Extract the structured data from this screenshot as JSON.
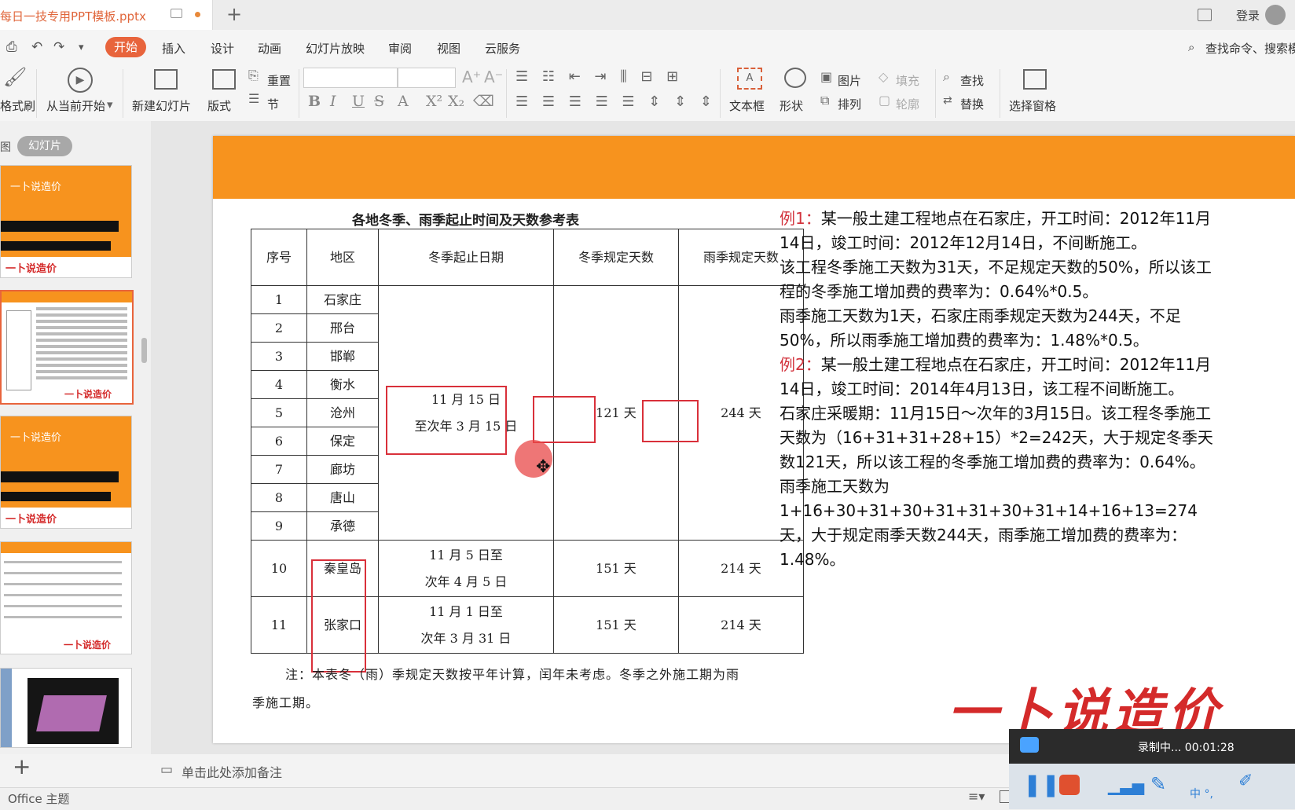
{
  "titlebar": {
    "doc_name": "每日一技专用PPT模板.pptx",
    "login": "登录",
    "new_tab": "+"
  },
  "menu": {
    "start": "开始",
    "items": [
      "插入",
      "设计",
      "动画",
      "幻灯片放映",
      "审阅",
      "视图",
      "云服务"
    ],
    "search": "查找命令、搜索模"
  },
  "ribbon": {
    "format_painter": "格式刷",
    "from_current": "从当前开始",
    "new_slide": "新建幻灯片",
    "layout": "版式",
    "reset": "重置",
    "section": "节",
    "textbox": "文本框",
    "shape": "形状",
    "picture": "图片",
    "arrange": "排列",
    "fill": "填充",
    "outline": "轮廓",
    "find": "查找",
    "replace": "替换",
    "select_pane": "选择窗格"
  },
  "left_panel": {
    "tab_outline": "图",
    "tab_slides": "幻灯片",
    "thumb_title": "一卜说造价",
    "thumb_logo": "一卜说造价"
  },
  "slide": {
    "table_title": "各地冬季、雨季起止时间及天数参考表",
    "headers": [
      "序号",
      "地区",
      "冬季起止日期",
      "冬季规定天数",
      "雨季规定天数"
    ],
    "rows": [
      {
        "no": "1",
        "region": "石家庄"
      },
      {
        "no": "2",
        "region": "邢台"
      },
      {
        "no": "3",
        "region": "邯郸"
      },
      {
        "no": "4",
        "region": "衡水"
      },
      {
        "no": "5",
        "region": "沧州"
      },
      {
        "no": "6",
        "region": "保定"
      },
      {
        "no": "7",
        "region": "廊坊"
      },
      {
        "no": "8",
        "region": "唐山"
      },
      {
        "no": "9",
        "region": "承德"
      }
    ],
    "group1": {
      "winter_dates_1": "11 月 15 日",
      "winter_dates_2": "至次年 3 月 15 日",
      "winter_days": "121 天",
      "rain_days": "244 天"
    },
    "row10": {
      "no": "10",
      "region": "秦皇岛",
      "winter_dates_1": "11 月 5 日至",
      "winter_dates_2": "次年 4 月 5 日",
      "winter_days": "151 天",
      "rain_days": "214 天"
    },
    "row11": {
      "no": "11",
      "region": "张家口",
      "winter_dates_1": "11 月 1 日至",
      "winter_dates_2": "次年 3 月 31 日",
      "winter_days": "151 天",
      "rain_days": "214 天"
    },
    "note": "注：本表冬（雨）季规定天数按平年计算，闰年未考虑。冬季之外施工期为雨季施工期。",
    "example1_label": "例1：",
    "example1_text": "某一般土建工程地点在石家庄，开工时间：2012年11月14日，竣工时间：2012年12月14日，不间断施工。",
    "example1_p2": "该工程冬季施工天数为31天，不足规定天数的50%，所以该工程的冬季施工增加费的费率为：0.64%*0.5。",
    "example1_p3": "雨季施工天数为1天，石家庄雨季规定天数为244天，不足50%，所以雨季施工增加费的费率为：1.48%*0.5。",
    "example2_label": "例2：",
    "example2_text": "某一般土建工程地点在石家庄，开工时间：2012年11月14日，竣工时间：2014年4月13日，该工程不间断施工。",
    "example2_p2": "石家庄采暖期：11月15日～次年的3月15日。该工程冬季施工天数为（16+31+31+28+15）*2=242天，大于规定冬季天数121天，所以该工程的冬季施工增加费的费率为：0.64%。",
    "example2_p3": "雨季施工天数为1+16+30+31+30+31+31+30+31+14+16+13=274天，大于规定雨季天数244天，雨季施工增加费的费率为：1.48%。",
    "watermark": "一卜说造价"
  },
  "notes_placeholder": "单击此处添加备注",
  "status": {
    "theme": "Office 主题"
  },
  "recorder": {
    "status": "录制中... 00:01:28",
    "ime": "中 °,"
  },
  "colors": {
    "accent": "#e8643c",
    "banner": "#f7931e",
    "red_box": "#d9303a",
    "example_label": "#d2333d"
  }
}
